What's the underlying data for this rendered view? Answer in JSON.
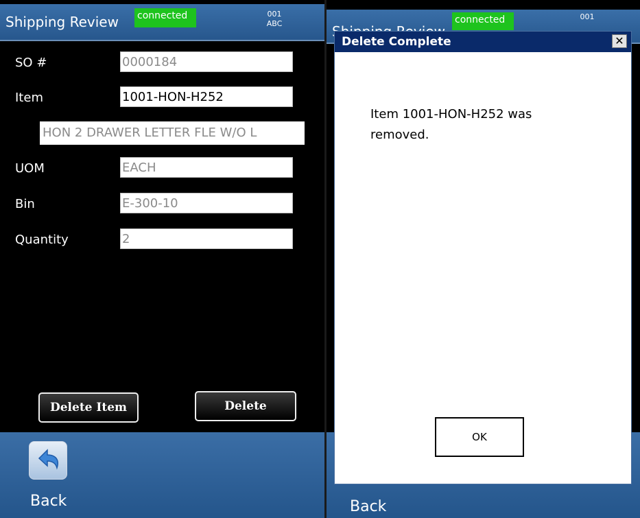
{
  "left": {
    "title": "Shipping Review",
    "status": "connected",
    "code_line1": "001",
    "code_line2": "ABC",
    "fields": {
      "so_label": "SO #",
      "so_value": "0000184",
      "item_label": "Item",
      "item_value": "1001-HON-H252",
      "description": "HON 2 DRAWER LETTER FLE W/O L",
      "uom_label": "UOM",
      "uom_value": "EACH",
      "bin_label": "Bin",
      "bin_value": "E-300-10",
      "qty_label": "Quantity",
      "qty_value": "2"
    },
    "buttons": {
      "delete_item": "Delete Item",
      "delete": "Delete"
    },
    "back_label": "Back"
  },
  "right": {
    "title": "Shipping Review",
    "status": "connected",
    "code_line1": "001",
    "back_label": "Back"
  },
  "dialog": {
    "title": "Delete Complete",
    "close_glyph": "✕",
    "message": "Item 1001-HON-H252 was removed.",
    "ok_label": "OK"
  },
  "colors": {
    "titlebar": "#2f64a0",
    "connected": "#1ec31e",
    "dialog_title": "#0a2a6a",
    "footer": "#2b5f97",
    "background": "#000000"
  },
  "icons": {
    "back": "back-arrow-icon"
  }
}
